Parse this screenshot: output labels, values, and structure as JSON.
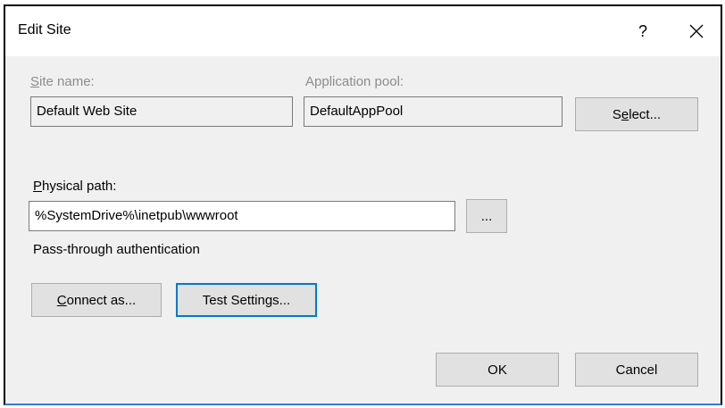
{
  "window": {
    "title": "Edit Site",
    "help_label": "?"
  },
  "site_name": {
    "label_mnemonic": "S",
    "label_rest": "ite name:",
    "value": "Default Web Site"
  },
  "app_pool": {
    "label": "Application pool:",
    "value": "DefaultAppPool"
  },
  "select_button": {
    "pre": "S",
    "mnemonic": "e",
    "post": "lect..."
  },
  "physical_path": {
    "label_mnemonic": "P",
    "label_rest": "hysical path:",
    "value": "%SystemDrive%\\inetpub\\wwwroot"
  },
  "browse_button": {
    "label": "..."
  },
  "pass_through_label": "Pass-through authentication",
  "connect_as_button": {
    "mnemonic": "C",
    "rest": "onnect as..."
  },
  "test_settings_button": {
    "label": "Test Settings..."
  },
  "ok_button": {
    "label": "OK"
  },
  "cancel_button": {
    "label": "Cancel"
  }
}
